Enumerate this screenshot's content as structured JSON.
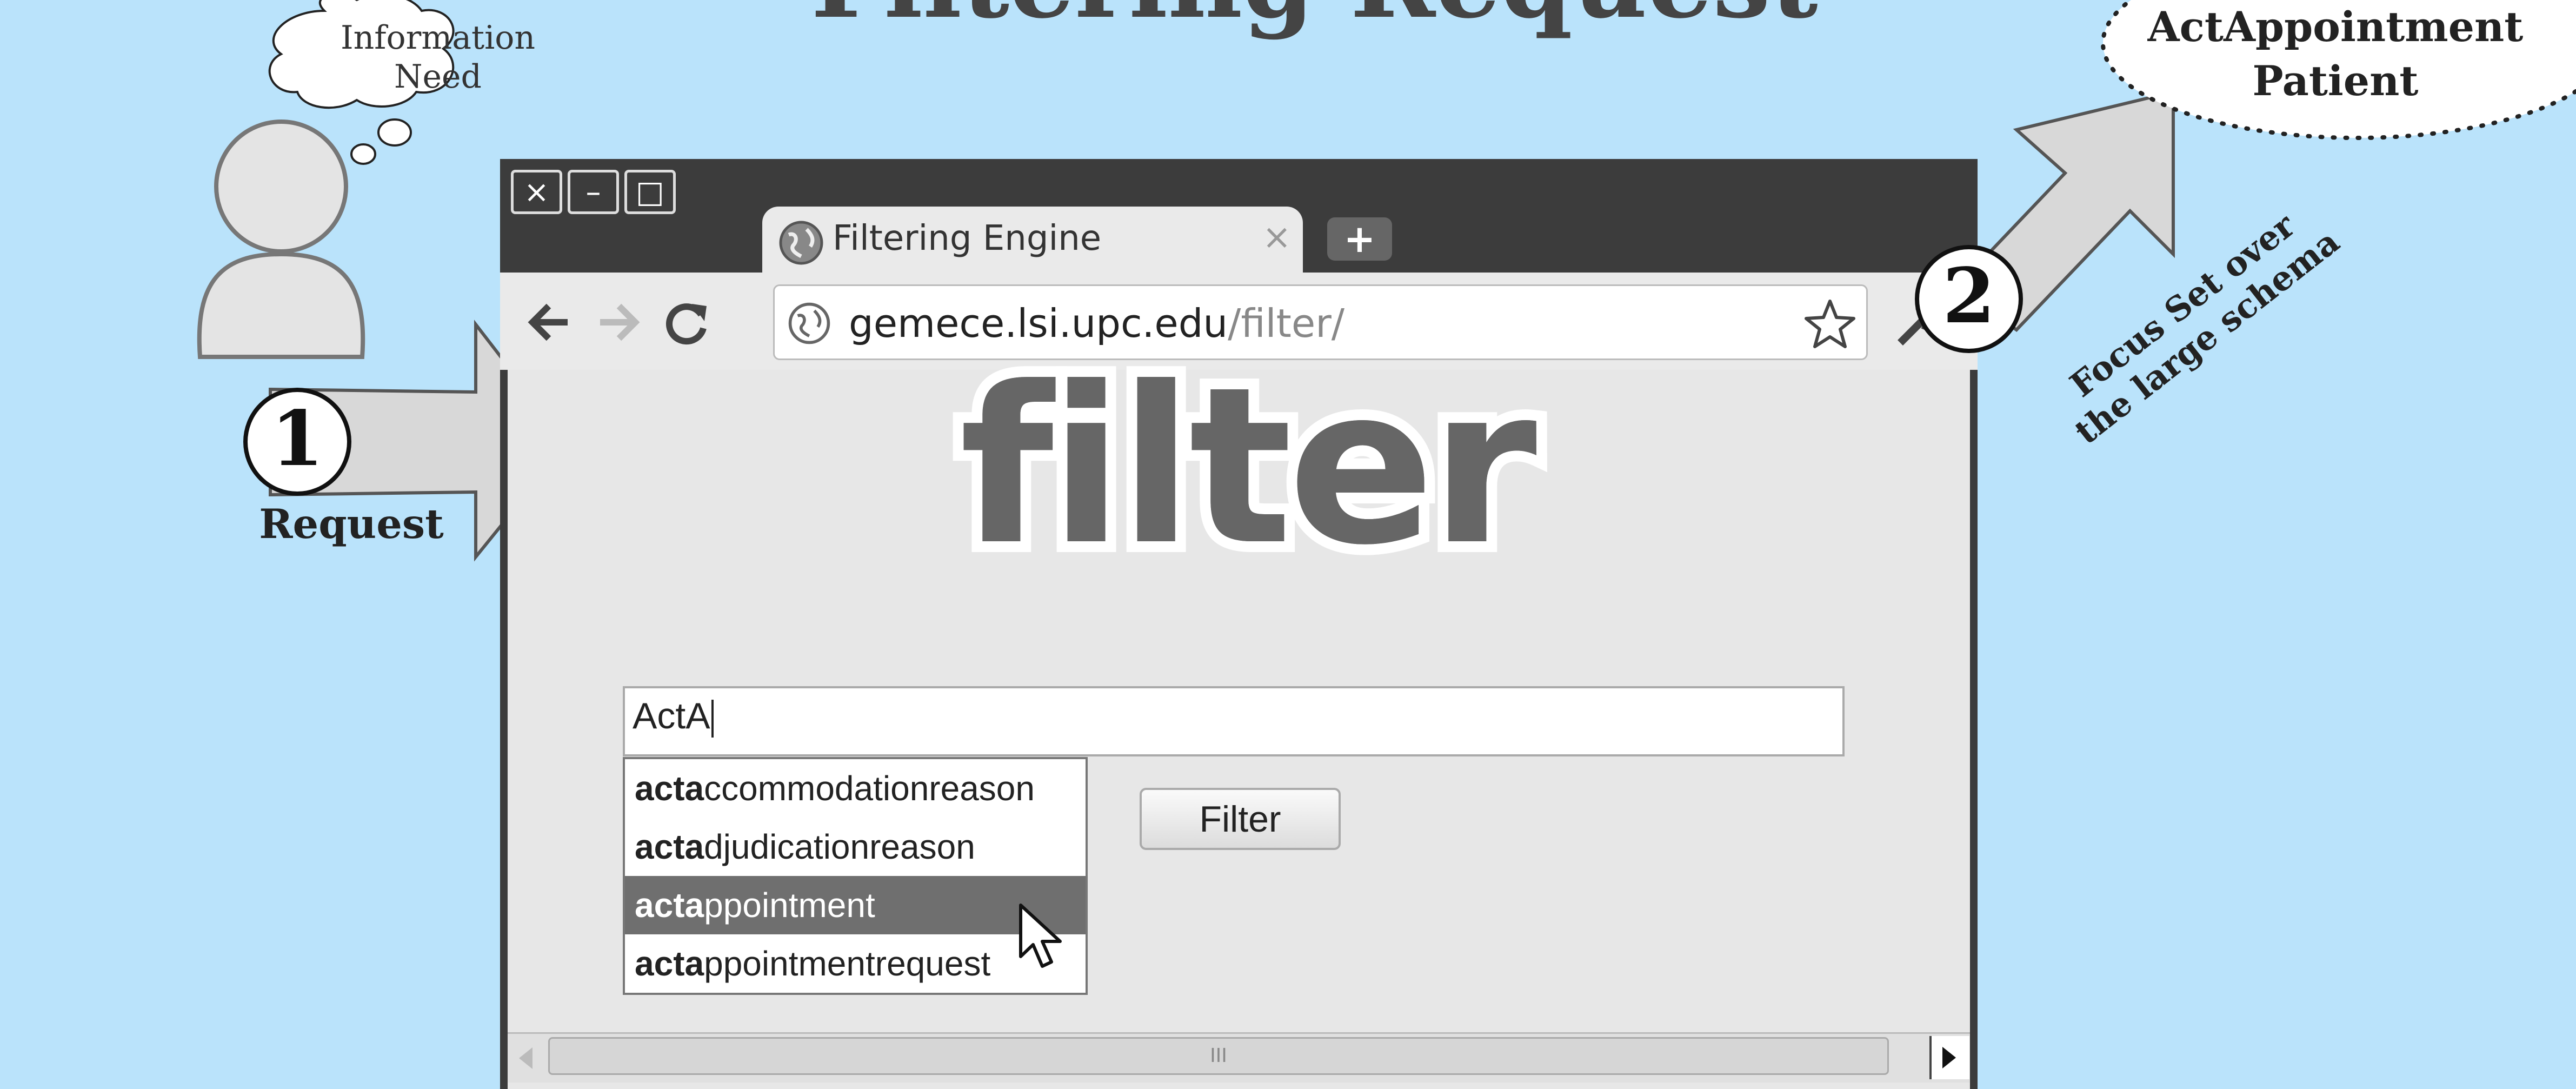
{
  "slide": {
    "title": "Filtering Request",
    "thought_bubble": [
      "Information",
      "Need"
    ],
    "step1": {
      "number": "1",
      "label": "Request"
    },
    "step2": {
      "number": "2",
      "label_line1": "Focus Set over",
      "label_line2": "the large schema"
    },
    "result": {
      "line1": "ActAppointment",
      "line2": "Patient"
    }
  },
  "browser": {
    "window_buttons": [
      "×",
      "–",
      "□"
    ],
    "tab_title": "Filtering Engine",
    "tab_close": "×",
    "new_tab": "+",
    "url_host": "gemece.lsi.upc.edu",
    "url_path": "/filter/",
    "logo_text": "filter",
    "search": {
      "value": "ActA"
    },
    "filter_button": "Filter",
    "suggestions": [
      {
        "bold": "acta",
        "rest": "ccommodationreason",
        "selected": false
      },
      {
        "bold": "acta",
        "rest": "djudicationreason",
        "selected": false
      },
      {
        "bold": "acta",
        "rest": "ppointment",
        "selected": true
      },
      {
        "bold": "acta",
        "rest": "ppointmentrequest",
        "selected": false
      }
    ],
    "scroll_thumb": "III"
  },
  "colors": {
    "background": "#bae3fb",
    "browser_frame": "#3c3c3c",
    "selected_row": "#6f6f6f"
  }
}
